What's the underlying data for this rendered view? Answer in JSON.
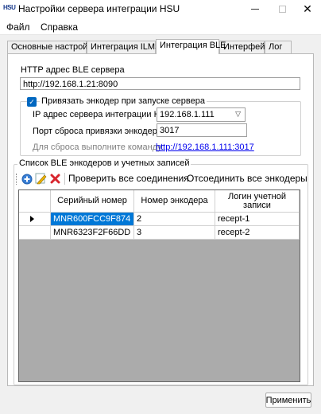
{
  "window": {
    "app_icon_text": "HSU",
    "title": "Настройки сервера интеграции HSU",
    "minimize_glyph": "—",
    "close_glyph": "✕"
  },
  "menu": {
    "file": "Файл",
    "help": "Справка"
  },
  "tabs": [
    {
      "label": "Основные настройки",
      "active": false
    },
    {
      "label": "Интеграция ILMS",
      "active": false
    },
    {
      "label": "Интеграция BLE",
      "active": true
    },
    {
      "label": "Интерфейс",
      "active": false
    },
    {
      "label": "Лог",
      "active": false
    }
  ],
  "ble": {
    "http_label": "HTTP адрес BLE сервера",
    "http_value": "http://192.168.1.21:8090",
    "bind_group": {
      "checkbox_label": "Привязать энкодер при запуске сервера",
      "checked": true,
      "ip_label": "IP адрес сервера интеграции HSU",
      "ip_value": "192.168.1.111",
      "port_label": "Порт сброса привязки энкодера:",
      "port_value": "3017",
      "reset_hint": "Для сброса выполните команду:",
      "reset_link": "http://192.168.1.111:3017"
    },
    "list_group": {
      "title": "Список BLE энкодеров и учетных записей",
      "toolbar": {
        "check_all": "Проверить все соединения",
        "disconnect_all": "Отсоединить все энкодеры"
      },
      "columns": [
        "Серийный номер",
        "Номер энкодера",
        "Логин учетной записи"
      ],
      "rows": [
        {
          "serial": "MNR600FCC9F874",
          "encoder": "2",
          "login": "recept-1",
          "current": true
        },
        {
          "serial": "MNR6323F2F66DD",
          "encoder": "3",
          "login": "recept-2",
          "current": false
        }
      ]
    }
  },
  "apply_label": "Применить",
  "colors": {
    "accent": "#0078d7",
    "checkbox": "#0067c0",
    "link": "#0000ee",
    "grid_empty": "#ababab"
  },
  "icons": [
    "app-icon",
    "add-icon",
    "edit-icon",
    "delete-icon",
    "chevron-down-icon",
    "row-pointer-icon"
  ]
}
